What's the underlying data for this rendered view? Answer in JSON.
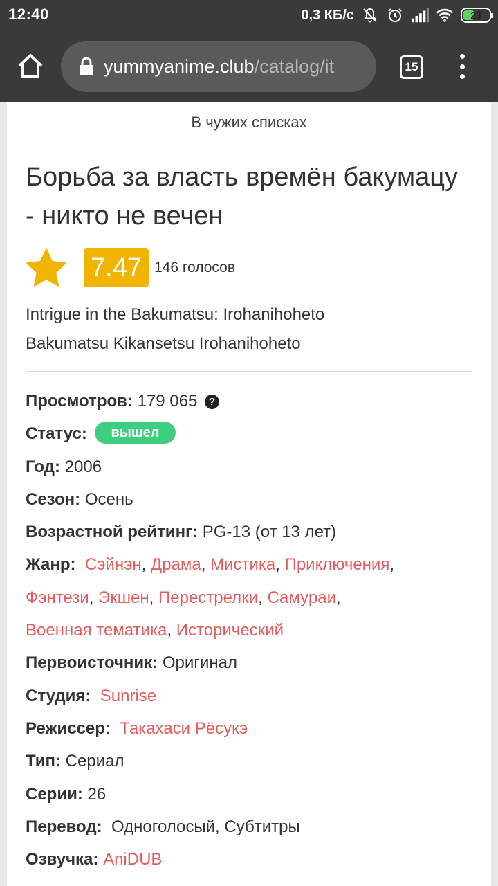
{
  "status_bar": {
    "time": "12:40",
    "speed": "0,3 КБ/с",
    "icons": [
      "bell-off-icon",
      "alarm-icon",
      "signal-icon",
      "wifi-icon"
    ],
    "battery": "23"
  },
  "browser": {
    "url_host": "yummyanime.club",
    "url_path": "/catalog/it",
    "tab_count": "15"
  },
  "page": {
    "in_lists": "В чужих списках",
    "title": "Борьба за власть времён бакумацу - никто не вечен",
    "rating": "7.47",
    "votes": "146 голосов",
    "alt_titles": [
      "Intrigue in the Bakumatsu: Irohanihoheto",
      "Bakumatsu Kikansetsu Irohanihoheto"
    ],
    "info": {
      "views_label": "Просмотров:",
      "views": "179 065",
      "status_label": "Статус:",
      "status": "вышел",
      "year_label": "Год:",
      "year": "2006",
      "season_label": "Сезон:",
      "season": "Осень",
      "age_label": "Возрастной рейтинг:",
      "age": "PG-13 (от 13 лет)",
      "genre_label": "Жанр:",
      "genres": [
        "Сэйнэн",
        "Драма",
        "Мистика",
        "Приключения",
        "Фэнтези",
        "Экшен",
        "Перестрелки",
        "Самураи",
        "Военная тематика",
        "Исторический"
      ],
      "source_label": "Первоисточник:",
      "source": "Оригинал",
      "studio_label": "Студия:",
      "studio": "Sunrise",
      "director_label": "Режиссер:",
      "director": "Такахаси Рёсукэ",
      "type_label": "Тип:",
      "type": "Сериал",
      "episodes_label": "Серии:",
      "episodes": "26",
      "translation_label": "Перевод:",
      "translation": "Одноголосый, Субтитры",
      "dub_label": "Озвучка:",
      "dub": "AniDUB"
    }
  },
  "colors": {
    "link": "#e55c5c",
    "rating_bg": "#f1b400",
    "status_badge": "#3ecf7e",
    "chrome_bar": "#3a3a3a"
  }
}
